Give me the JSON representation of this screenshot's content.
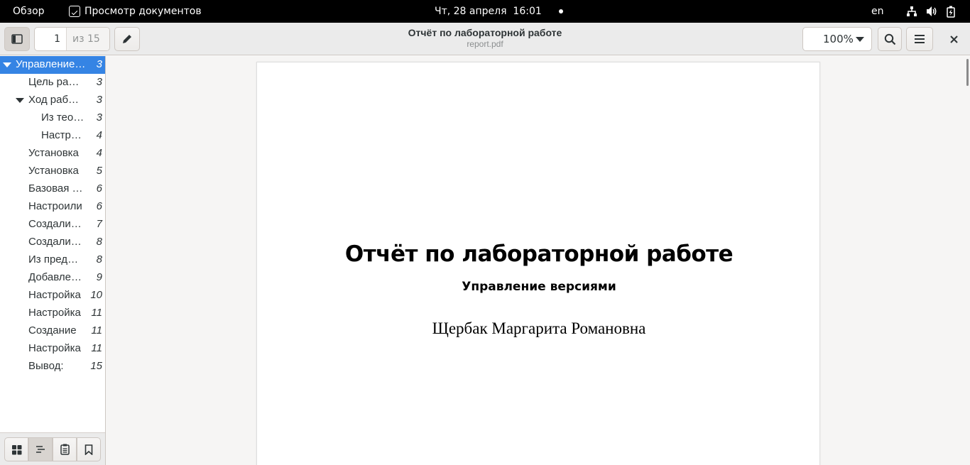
{
  "topbar": {
    "activities": "Обзор",
    "app_name": "Просмотр документов",
    "clock": "Чт, 28 апреля  16:01",
    "lang": "en"
  },
  "headerbar": {
    "page_current": "1",
    "page_total": "из 15",
    "title": "Отчёт по лабораторной работе",
    "subtitle": "report.pdf",
    "zoom": "100%"
  },
  "outline": [
    {
      "label": "Управление версиями",
      "page": "3",
      "level": 0,
      "expanded": true,
      "selected": true
    },
    {
      "label": "Цель работы",
      "page": "3",
      "level": 1
    },
    {
      "label": "Ход работы",
      "page": "3",
      "level": 1,
      "expanded": true
    },
    {
      "label": "Из теории",
      "page": "3",
      "level": 2
    },
    {
      "label": "Настройка",
      "page": "4",
      "level": 2
    },
    {
      "label": "Установка",
      "page": "4",
      "level": 1
    },
    {
      "label": "Установка",
      "page": "5",
      "level": 1
    },
    {
      "label": "Базовая настройка",
      "page": "6",
      "level": 1
    },
    {
      "label": "Настроили",
      "page": "6",
      "level": 1
    },
    {
      "label": "Создали ключ",
      "page": "7",
      "level": 1
    },
    {
      "label": "Создали ключ",
      "page": "8",
      "level": 1
    },
    {
      "label": "Из предложенных",
      "page": "8",
      "level": 1
    },
    {
      "label": "Добавление",
      "page": "9",
      "level": 1
    },
    {
      "label": "Настройка",
      "page": "10",
      "level": 1
    },
    {
      "label": "Настройка",
      "page": "11",
      "level": 1
    },
    {
      "label": "Создание",
      "page": "11",
      "level": 1
    },
    {
      "label": "Настройка",
      "page": "11",
      "level": 1
    },
    {
      "label": "Вывод:",
      "page": "15",
      "level": 1
    }
  ],
  "document": {
    "title": "Отчёт по лабораторной работе",
    "subtitle": "Управление версиями",
    "author": "Щербак Маргарита Романовна"
  },
  "colors": {
    "accent": "#3584e4",
    "headerbar": "#ebebeb",
    "topbar": "#000000"
  }
}
